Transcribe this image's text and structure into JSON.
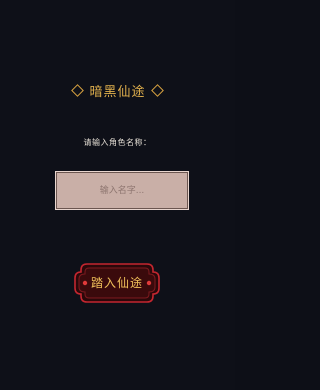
{
  "title": "暗黑仙途",
  "prompt": "请输入角色名称：",
  "name_input": {
    "value": "",
    "placeholder": "输入名字..."
  },
  "enter_button": {
    "label": "踏入仙途"
  },
  "colors": {
    "background": "#0e1018",
    "accent_gold": "#d9a441",
    "button_fill": "#3a0a0c",
    "button_border": "#b3202a",
    "input_fill": "#c9afa7"
  },
  "icons": [
    "diamond-icon",
    "diamond-icon"
  ]
}
